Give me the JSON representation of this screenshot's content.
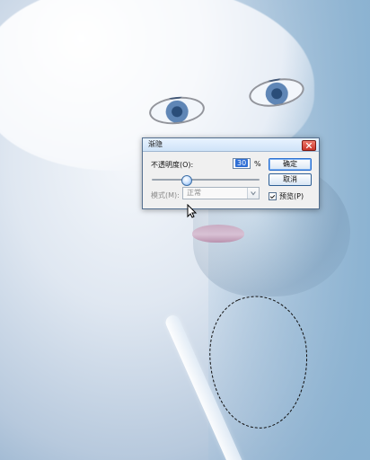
{
  "dialog": {
    "title": "渐隐",
    "opacity_label": "不透明度(O):",
    "opacity_value": "30",
    "opacity_unit": "%",
    "opacity_fraction": 0.3,
    "mode_label": "模式(M):",
    "mode_value": "正常",
    "ok_label": "确定",
    "cancel_label": "取消",
    "preview_label": "预览(P)",
    "preview_checked": true
  },
  "colors": {
    "dialog_bg": "#f0f0f0",
    "title_bg": "#cfe3f8",
    "accent": "#2f6fd6",
    "close_red": "#c9342a"
  },
  "icons": {
    "close": "close-icon",
    "slider_cursor": "cursor-icon",
    "dropdown": "chevron-down-icon",
    "checkbox": "check-icon"
  }
}
